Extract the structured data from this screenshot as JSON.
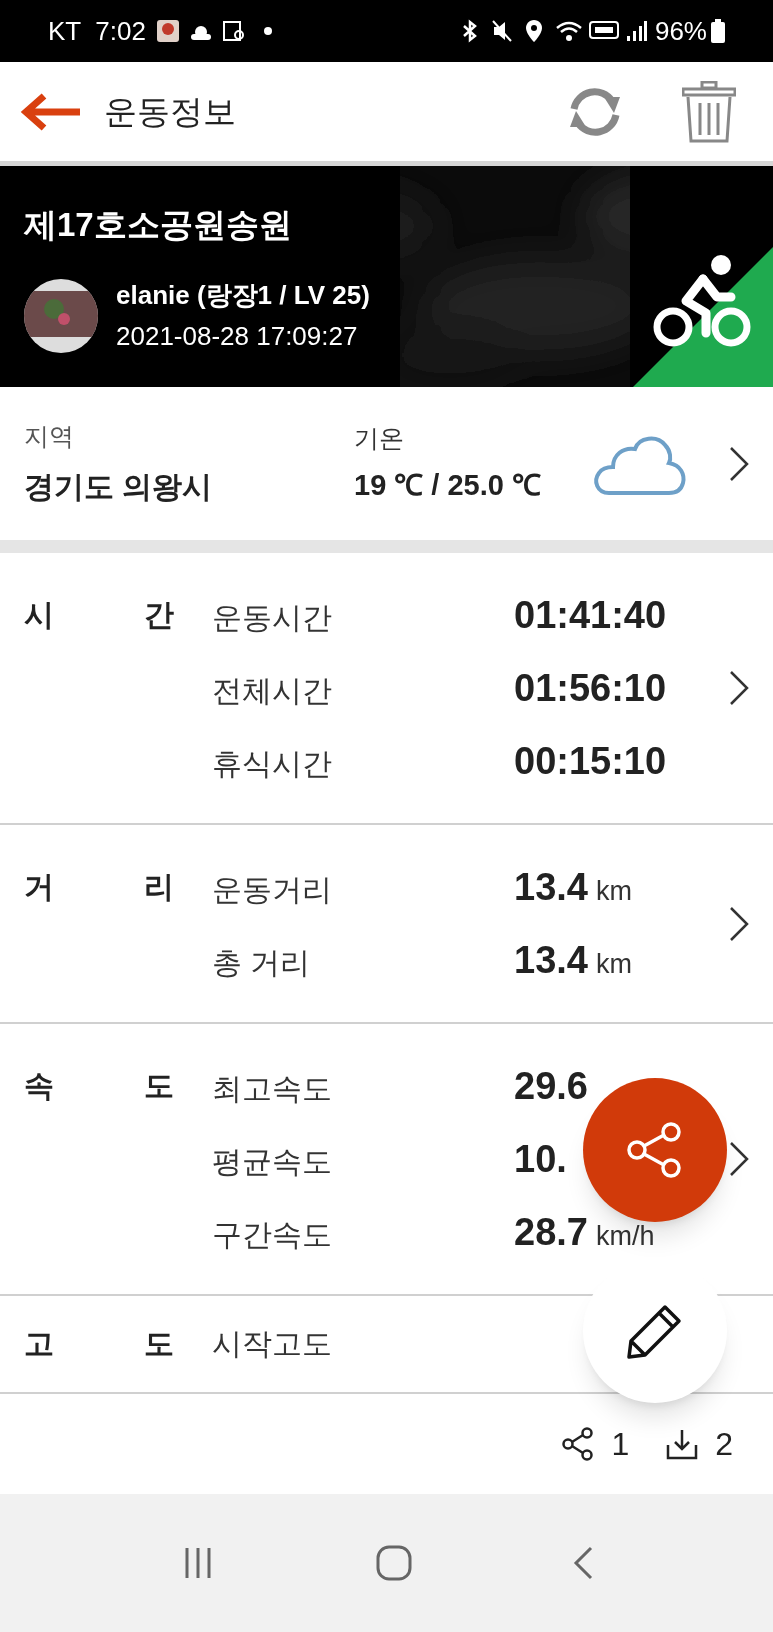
{
  "status_bar": {
    "carrier": "KT",
    "time": "7:02",
    "battery": "96%"
  },
  "header": {
    "title": "운동정보"
  },
  "banner": {
    "title": "제17호소공원송원",
    "user": "elanie (랑장1 / LV 25)",
    "datetime": "2021-08-28 17:09:27"
  },
  "location": {
    "region_label": "지역",
    "region": "경기도 의왕시",
    "temp_label": "기온",
    "temperature": "19 ℃ / 25.0 ℃"
  },
  "sections": [
    {
      "label": [
        "시",
        "간"
      ],
      "chevron": true,
      "rows": [
        {
          "name": "운동시간",
          "value": "01:41:40"
        },
        {
          "name": "전체시간",
          "value": "01:56:10"
        },
        {
          "name": "휴식시간",
          "value": "00:15:10"
        }
      ]
    },
    {
      "label": [
        "거",
        "리"
      ],
      "chevron": true,
      "rows": [
        {
          "name": "운동거리",
          "value": "13.4",
          "unit": "km"
        },
        {
          "name": "총 거리",
          "value": "13.4",
          "unit": "km"
        }
      ]
    },
    {
      "label": [
        "속",
        "도"
      ],
      "chevron": true,
      "rows": [
        {
          "name": "최고속도",
          "value": "29.6"
        },
        {
          "name": "평균속도",
          "value": "10."
        },
        {
          "name": "구간속도",
          "value": "28.7",
          "unit": "km/h"
        }
      ]
    },
    {
      "label": [
        "고",
        "도"
      ],
      "chevron": false,
      "rows": [
        {
          "name": "시작고도"
        }
      ]
    }
  ],
  "footer": {
    "shares": "1",
    "downloads": "2"
  }
}
